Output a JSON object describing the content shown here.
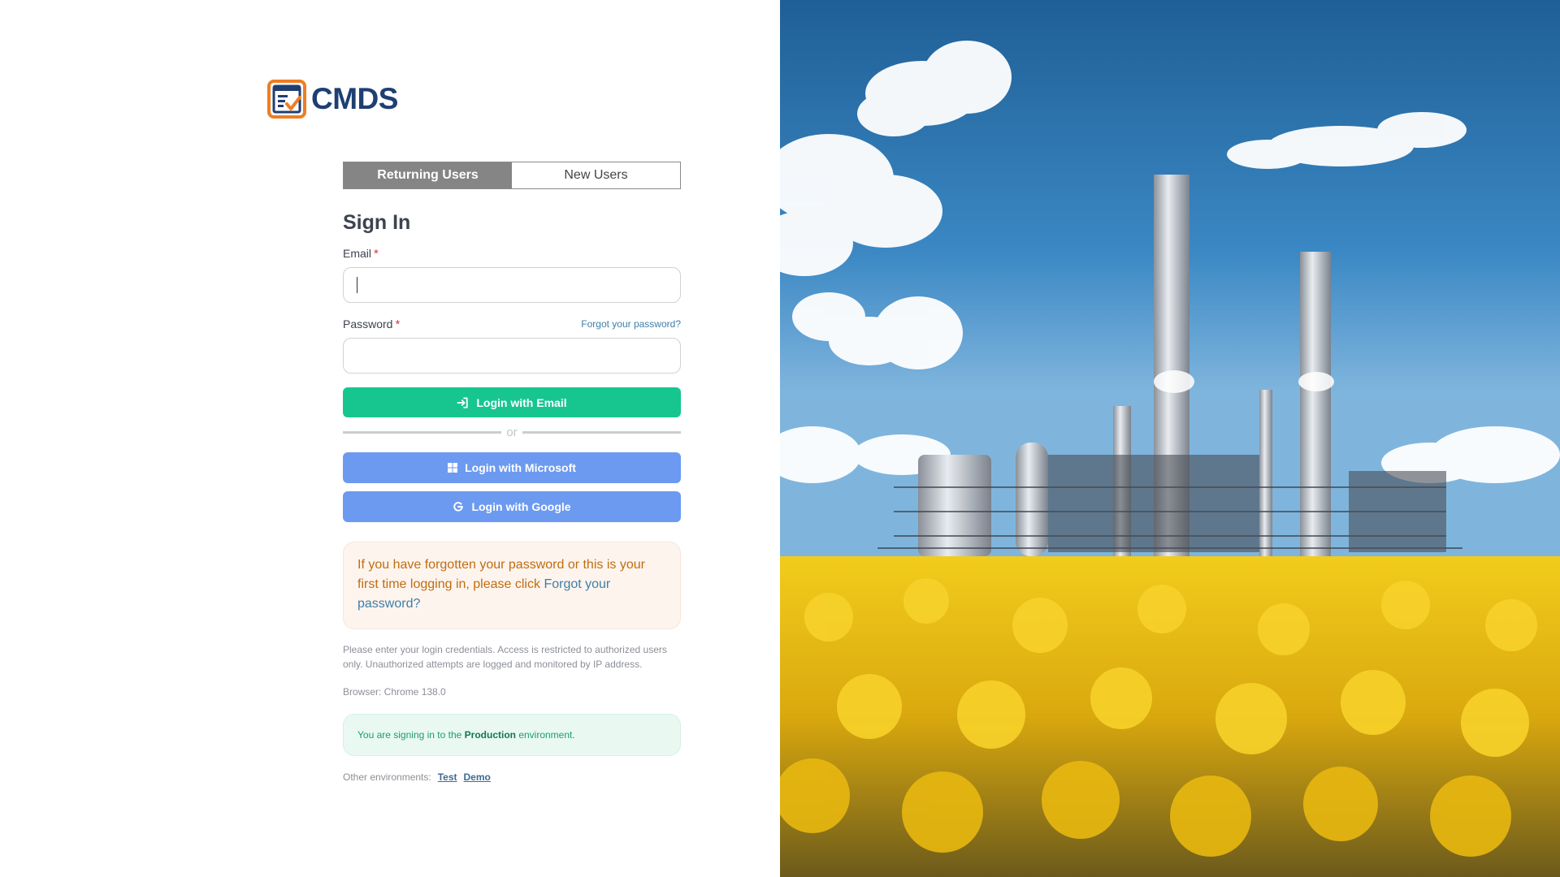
{
  "brand": {
    "name": "CMDS"
  },
  "tabs": [
    {
      "label": "Returning Users",
      "active": true
    },
    {
      "label": "New Users",
      "active": false
    }
  ],
  "signin": {
    "title": "Sign In",
    "email_label": "Email",
    "email_value": "",
    "password_label": "Password",
    "password_value": "",
    "required_marker": "*",
    "forgot_link": "Forgot your password?"
  },
  "buttons": {
    "email": "Login with Email",
    "microsoft": "Login with Microsoft",
    "google": "Login with Google"
  },
  "divider": {
    "text": "or"
  },
  "notice": {
    "text": "If you have forgotten your password or this is your first time logging in, please click ",
    "link": "Forgot your password?"
  },
  "disclaimer": "Please enter your login credentials. Access is restricted to authorized users only. Unauthorized attempts are logged and monitored by IP address.",
  "browser": "Browser: Chrome 138.0",
  "environment": {
    "prefix": "You are signing in to the ",
    "name": "Production",
    "suffix": " environment."
  },
  "other_environments": {
    "label": "Other environments:",
    "links": [
      "Test",
      "Demo"
    ]
  },
  "colors": {
    "email_button": "#17c68f",
    "sso_button": "#6c9af0",
    "active_tab": "#858585",
    "brand_orange": "#ef7d22",
    "brand_navy": "#1f3f72"
  }
}
